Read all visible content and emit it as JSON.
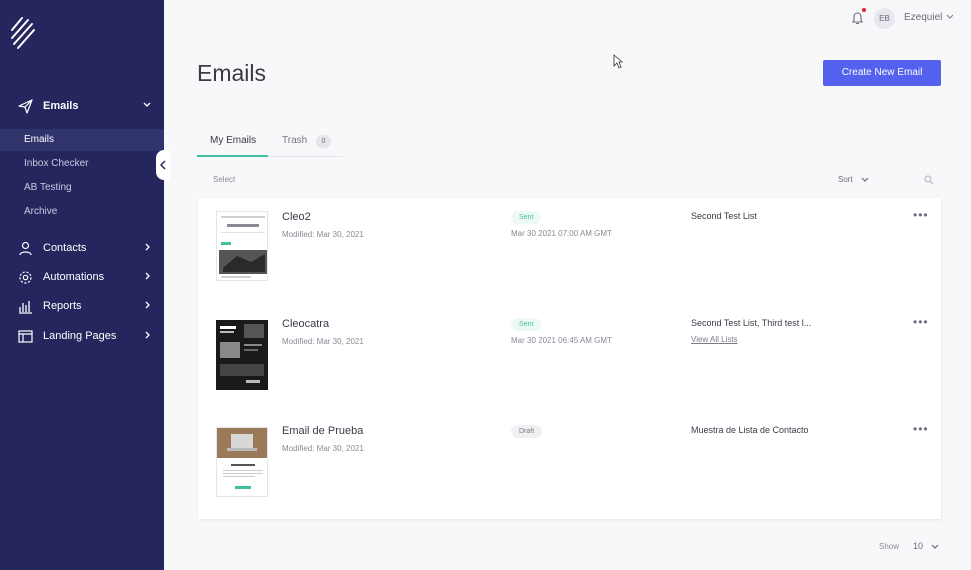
{
  "sidebar": {
    "main_item": "Emails",
    "sub_items": [
      "Emails",
      "Inbox Checker",
      "AB Testing",
      "Archive"
    ],
    "items": [
      "Contacts",
      "Automations",
      "Reports",
      "Landing Pages"
    ]
  },
  "header": {
    "avatar_initials": "EB",
    "user_name": "Ezequiel"
  },
  "page": {
    "title": "Emails",
    "create_button": "Create New Email"
  },
  "tabs": {
    "my_emails": "My Emails",
    "trash": "Trash",
    "trash_count": "0"
  },
  "toolbar": {
    "select": "Select",
    "sort": "Sort"
  },
  "emails": [
    {
      "name": "Cleo2",
      "modified": "Modified: Mar 30, 2021",
      "status": "Sent",
      "date": "Mar 30 2021 07:00 AM GMT",
      "lists": "Second Test List",
      "view_all": ""
    },
    {
      "name": "Cleocatra",
      "modified": "Modified: Mar 30, 2021",
      "status": "Sent",
      "date": "Mar 30 2021 06:45 AM GMT",
      "lists": "Second Test List, Third test l...",
      "view_all": "View All Lists"
    },
    {
      "name": "Email de Prueba",
      "modified": "Modified: Mar 30, 2021",
      "status": "Draft",
      "date": "",
      "lists": "Muestra de Lista de Contacto",
      "view_all": ""
    }
  ],
  "pagination": {
    "show_label": "Show",
    "show_value": "10"
  },
  "colors": {
    "sidebar": "#25265e",
    "primary_button": "#5461ee",
    "tab_accent": "#3fc1a1"
  }
}
